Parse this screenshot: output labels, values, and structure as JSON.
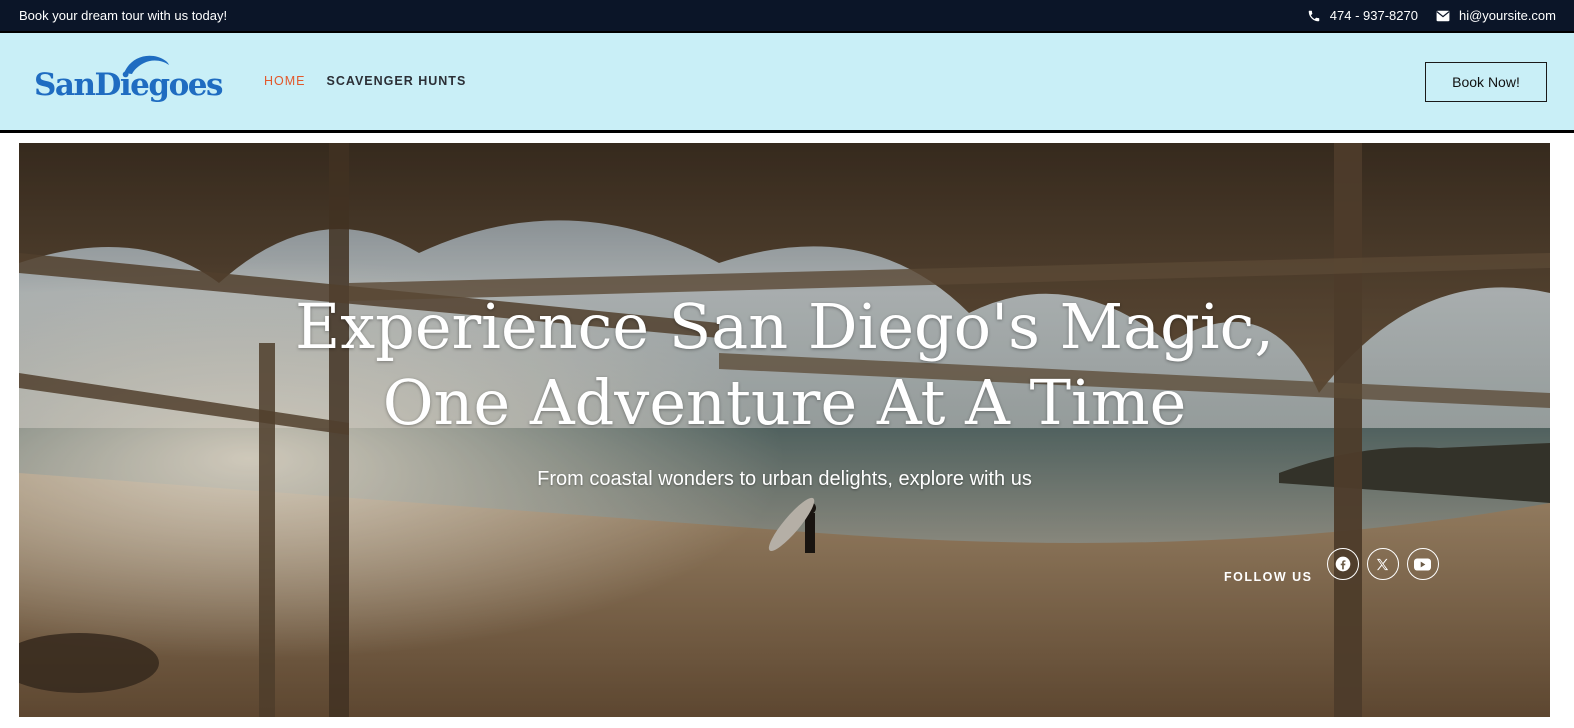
{
  "topbar": {
    "tagline": "Book your dream tour with us today!",
    "phone": "474 - 937-8270",
    "email": "hi@yoursite.com"
  },
  "header": {
    "logo_text": "SanDiegoes",
    "nav": [
      {
        "label": "HOME",
        "active": true
      },
      {
        "label": "SCAVENGER HUNTS",
        "active": false
      }
    ],
    "cta": "Book Now!"
  },
  "hero": {
    "title_line1": "Experience San Diego's Magic,",
    "title_line2": "One Adventure At A Time",
    "subtitle": "From coastal wonders to urban delights, explore with us",
    "follow_label": "FOLLOW US",
    "socials": [
      "facebook-icon",
      "x-icon",
      "youtube-icon"
    ]
  },
  "colors": {
    "topbar_bg": "#0b1528",
    "header_bg": "#c9eff7",
    "logo_blue": "#1f6cc1",
    "nav_active": "#e2582b"
  }
}
